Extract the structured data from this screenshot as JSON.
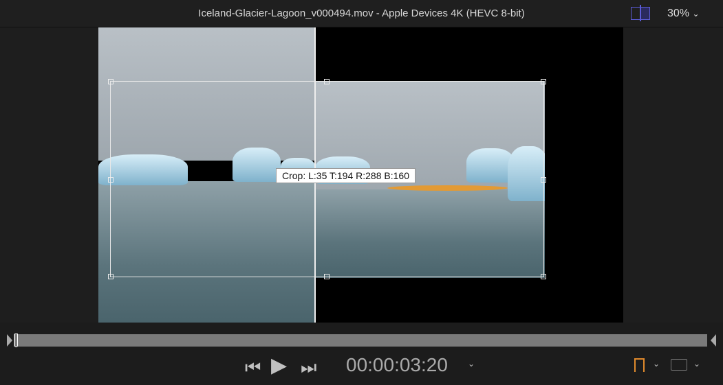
{
  "window": {
    "title": "Iceland-Glacier-Lagoon_v000494.mov - Apple Devices 4K (HEVC 8-bit)",
    "zoom": "30%",
    "zoom_chevron": "⌄"
  },
  "viewer": {
    "crop_label": "Crop: L:35 T:194 R:288 B:160"
  },
  "transport": {
    "timecode": "00:00:03:20",
    "prev": "⏮",
    "play": "▶",
    "next": "⏭",
    "chevron": "⌄"
  },
  "playhead_fraction": 0.0,
  "colors": {
    "accent": "#5b5bd6",
    "marker": "#e08a2c"
  }
}
